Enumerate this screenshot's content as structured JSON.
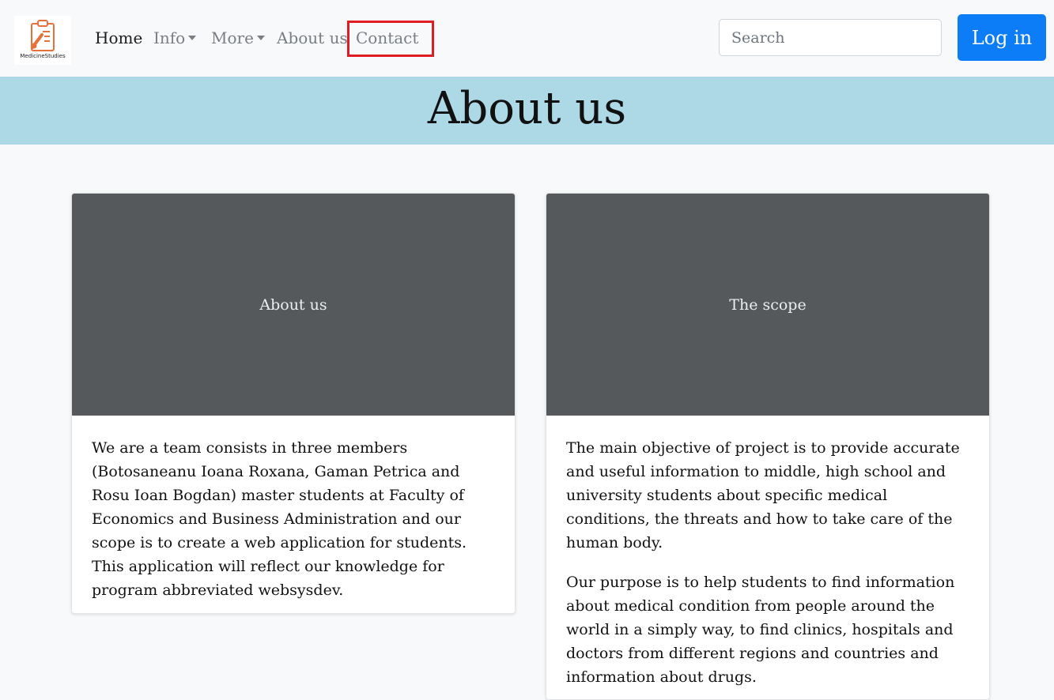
{
  "brand": {
    "logo_text": "MedicineStudies",
    "accent_color": "#e8713a"
  },
  "nav": {
    "home": "Home",
    "info": "Info",
    "more": "More",
    "about": "About us",
    "contact": "Contact"
  },
  "search": {
    "placeholder": "Search"
  },
  "login": {
    "label": "Log in",
    "color": "#0d7cf7"
  },
  "hero": {
    "title": "About us",
    "background": "#add8e6"
  },
  "cards": [
    {
      "image_label": "About us",
      "paragraphs": [
        "We are a team consists in three members (Botosaneanu Ioana Roxana, Gaman Petrica and Rosu Ioan Bogdan) master students at Faculty of Economics and Business Administration and our scope is to create a web application for students. This application will reflect our knowledge for program abbreviated websysdev."
      ]
    },
    {
      "image_label": "The scope",
      "paragraphs": [
        "The main objective of project is to provide accurate and useful information to middle, high school and university students about specific medical conditions, the threats and how to take care of the human body.",
        "Our purpose is to help students to find information about medical condition from people around the world in a simply way, to find clinics, hospitals and doctors from different regions and countries and information about drugs."
      ]
    }
  ]
}
